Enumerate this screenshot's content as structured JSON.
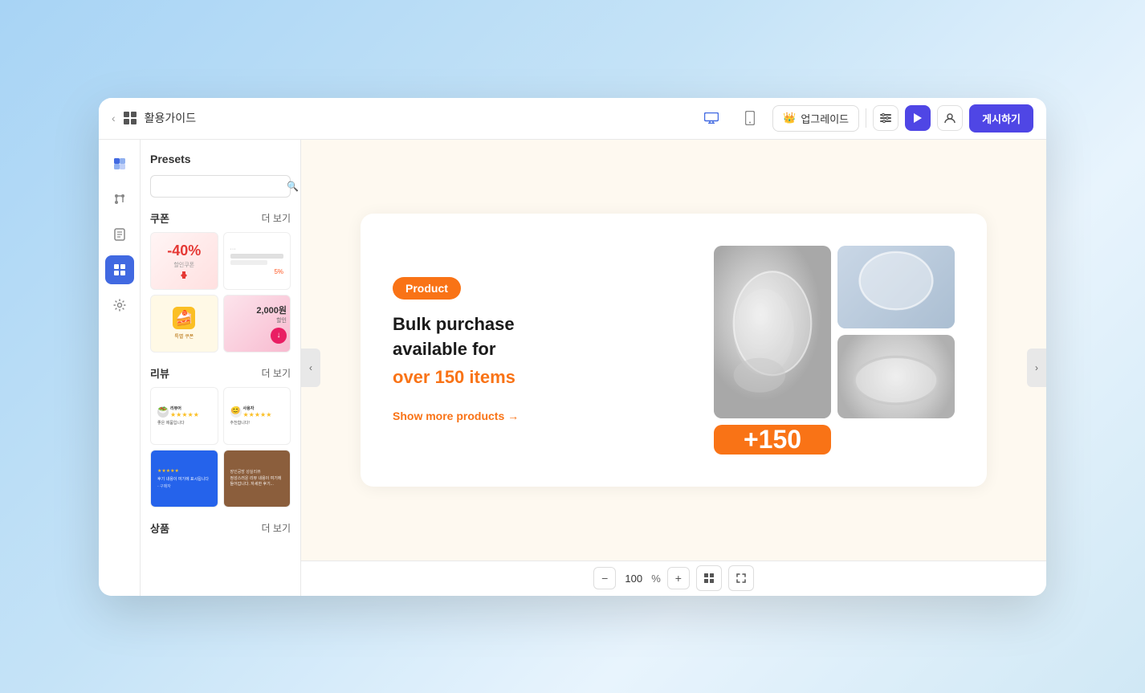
{
  "window": {
    "title": "활용가이드"
  },
  "topbar": {
    "back_label": "‹",
    "title": "활용가이드",
    "upgrade_label": "업그레이드",
    "publish_label": "게시하기",
    "desktop_icon": "🖥",
    "mobile_icon": "📱"
  },
  "sidebar": {
    "title": "Presets",
    "search_placeholder": "",
    "sections": [
      {
        "label": "쿠폰",
        "more": "더 보기"
      },
      {
        "label": "리뷰",
        "more": "더 보기"
      },
      {
        "label": "상품",
        "more": "더 보기"
      }
    ]
  },
  "canvas": {
    "badge": "Product",
    "heading1": "Bulk purchase",
    "heading2": "available for",
    "heading3": "over 150 items",
    "link": "Show more products →",
    "count": "+150",
    "zoom": "100",
    "zoom_pct": "%"
  },
  "toolbar": {
    "zoom_minus": "−",
    "zoom_plus": "+"
  }
}
